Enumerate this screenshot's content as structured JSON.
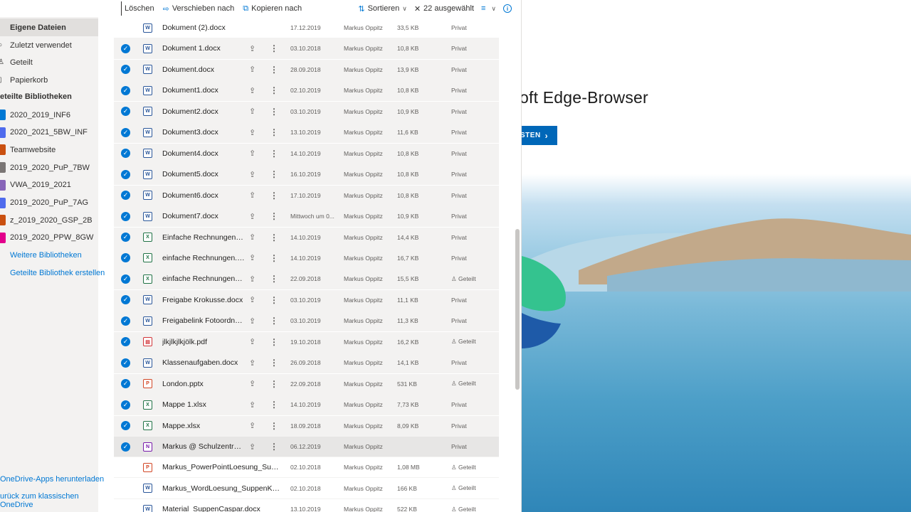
{
  "toolbar": {
    "delete_label": "Löschen",
    "move_label": "Verschieben nach",
    "copy_label": "Kopieren nach",
    "sort_label": "Sortieren",
    "selected_label": "22 ausgewählt"
  },
  "sidebar": {
    "items": [
      {
        "label": "Eigene Dateien",
        "active": true
      },
      {
        "label": "Zuletzt verwendet"
      },
      {
        "label": "Geteilt"
      },
      {
        "label": "Papierkorb"
      }
    ],
    "libraries_heading": "eteilte Bibliotheken",
    "libraries": [
      {
        "label": "2020_2019_INF6",
        "color": "#0078d4"
      },
      {
        "label": "2020_2021_5BW_INF",
        "color": "#4f6bed"
      },
      {
        "label": "Teamwebsite",
        "color": "#ca5010"
      },
      {
        "label": "2019_2020_PuP_7BW",
        "color": "#7a7574"
      },
      {
        "label": "VWA_2019_2021",
        "color": "#8764b8"
      },
      {
        "label": "2019_2020_PuP_7AG",
        "color": "#4f6bed"
      },
      {
        "label": "z_2019_2020_GSP_2B",
        "color": "#ca5010"
      },
      {
        "label": "2019_2020_PPW_8GW",
        "color": "#e3008c"
      }
    ],
    "more_libraries": "Weitere Bibliotheken",
    "create_library": "Geteilte Bibliothek erstellen",
    "footer_apps": "OneDrive-Apps herunterladen",
    "footer_back_1": "urück zum klassischen",
    "footer_back_2": "OneDrive"
  },
  "files": [
    {
      "name": "Dokument (2).docx",
      "type": "w",
      "date": "17.12.2019",
      "owner": "Markus Oppitz",
      "size": "33,5 KB",
      "sharing": "Privat",
      "selected": false
    },
    {
      "name": "Dokument 1.docx",
      "type": "w",
      "date": "03.10.2018",
      "owner": "Markus Oppitz",
      "size": "10,8 KB",
      "sharing": "Privat",
      "selected": true
    },
    {
      "name": "Dokument.docx",
      "type": "w",
      "date": "28.09.2018",
      "owner": "Markus Oppitz",
      "size": "13,9 KB",
      "sharing": "Privat",
      "selected": true
    },
    {
      "name": "Dokument1.docx",
      "type": "w",
      "date": "02.10.2019",
      "owner": "Markus Oppitz",
      "size": "10,8 KB",
      "sharing": "Privat",
      "selected": true
    },
    {
      "name": "Dokument2.docx",
      "type": "w",
      "date": "03.10.2019",
      "owner": "Markus Oppitz",
      "size": "10,9 KB",
      "sharing": "Privat",
      "selected": true
    },
    {
      "name": "Dokument3.docx",
      "type": "w",
      "date": "13.10.2019",
      "owner": "Markus Oppitz",
      "size": "11,6 KB",
      "sharing": "Privat",
      "selected": true
    },
    {
      "name": "Dokument4.docx",
      "type": "w",
      "date": "14.10.2019",
      "owner": "Markus Oppitz",
      "size": "10,8 KB",
      "sharing": "Privat",
      "selected": true
    },
    {
      "name": "Dokument5.docx",
      "type": "w",
      "date": "16.10.2019",
      "owner": "Markus Oppitz",
      "size": "10,8 KB",
      "sharing": "Privat",
      "selected": true
    },
    {
      "name": "Dokument6.docx",
      "type": "w",
      "date": "17.10.2019",
      "owner": "Markus Oppitz",
      "size": "10,8 KB",
      "sharing": "Privat",
      "selected": true
    },
    {
      "name": "Dokument7.docx",
      "type": "w",
      "date": "Mittwoch um 0...",
      "owner": "Markus Oppitz",
      "size": "10,9 KB",
      "sharing": "Privat",
      "selected": true
    },
    {
      "name": "Einfache Rechnungen 5.x...",
      "type": "x",
      "date": "14.10.2019",
      "owner": "Markus Oppitz",
      "size": "14,4 KB",
      "sharing": "Privat",
      "selected": true
    },
    {
      "name": "einfache Rechnungen.xlsx",
      "type": "x",
      "date": "14.10.2019",
      "owner": "Markus Oppitz",
      "size": "16,7 KB",
      "sharing": "Privat",
      "selected": true
    },
    {
      "name": "einfache Rechnungen1.xlsx",
      "type": "x",
      "date": "22.09.2018",
      "owner": "Markus Oppitz",
      "size": "15,5 KB",
      "sharing": "Geteilt",
      "selected": true
    },
    {
      "name": "Freigabe Krokusse.docx",
      "type": "w",
      "date": "03.10.2019",
      "owner": "Markus Oppitz",
      "size": "11,1 KB",
      "sharing": "Privat",
      "selected": true
    },
    {
      "name": "Freigabelink Fotoordner....",
      "type": "w",
      "date": "03.10.2019",
      "owner": "Markus Oppitz",
      "size": "11,3 KB",
      "sharing": "Privat",
      "selected": true
    },
    {
      "name": "jlkjlkjlkjölk.pdf",
      "type": "pdf",
      "date": "19.10.2018",
      "owner": "Markus Oppitz",
      "size": "16,2 KB",
      "sharing": "Geteilt",
      "selected": true
    },
    {
      "name": "Klassenaufgaben.docx",
      "type": "w",
      "date": "26.09.2018",
      "owner": "Markus Oppitz",
      "size": "14,1 KB",
      "sharing": "Privat",
      "selected": true
    },
    {
      "name": "London.pptx",
      "type": "p",
      "date": "22.09.2018",
      "owner": "Markus Oppitz",
      "size": "531 KB",
      "sharing": "Geteilt",
      "selected": true
    },
    {
      "name": "Mappe 1.xlsx",
      "type": "x",
      "date": "14.10.2019",
      "owner": "Markus Oppitz",
      "size": "7,73 KB",
      "sharing": "Privat",
      "selected": true
    },
    {
      "name": "Mappe.xlsx",
      "type": "x",
      "date": "18.09.2018",
      "owner": "Markus Oppitz",
      "size": "8,09 KB",
      "sharing": "Privat",
      "selected": true
    },
    {
      "name": "Markus @ Schulzentrum...",
      "type": "n",
      "date": "06.12.2019",
      "owner": "Markus Oppitz",
      "size": "",
      "sharing": "Privat",
      "selected": true,
      "hover": true
    },
    {
      "name": "Markus_PowerPointLoesung_Suppen...",
      "type": "p",
      "date": "02.10.2018",
      "owner": "Markus Oppitz",
      "size": "1,08 MB",
      "sharing": "Geteilt",
      "selected": false
    },
    {
      "name": "Markus_WordLoesung_SuppenKaspa...",
      "type": "w",
      "date": "02.10.2018",
      "owner": "Markus Oppitz",
      "size": "166 KB",
      "sharing": "Geteilt",
      "selected": false
    },
    {
      "name": "Material_SuppenCaspar.docx",
      "type": "w",
      "date": "13.10.2019",
      "owner": "Markus Oppitz",
      "size": "522 KB",
      "sharing": "Geteilt",
      "selected": false
    }
  ],
  "edge": {
    "headline": "oft Edge-Browser",
    "cta_label": "STEN"
  }
}
